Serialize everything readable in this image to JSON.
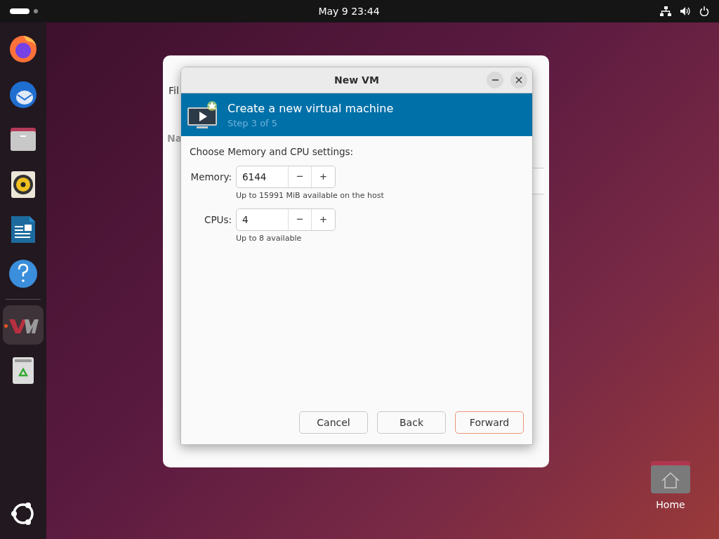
{
  "top_bar": {
    "clock": "May 9  23:44"
  },
  "dock": [
    {
      "kind": "firefox",
      "selected": false
    },
    {
      "kind": "thunderbird",
      "selected": false
    },
    {
      "kind": "files",
      "selected": false
    },
    {
      "kind": "rhythmbox",
      "selected": false
    },
    {
      "kind": "writer",
      "selected": false
    },
    {
      "kind": "help",
      "selected": false
    },
    {
      "kind": "vm",
      "selected": true
    },
    {
      "kind": "trash",
      "selected": false
    }
  ],
  "background_window": {
    "menu": "Fil",
    "column": "Na"
  },
  "dialog": {
    "title": "New VM",
    "banner": {
      "title": "Create a new virtual machine",
      "subtitle": "Step 3 of 5"
    },
    "heading": "Choose Memory and CPU settings:",
    "fields": [
      {
        "label": "Memory:",
        "value": "6144",
        "minus": "−",
        "plus": "+",
        "hint": "Up to 15991 MiB available on the host"
      },
      {
        "label": "CPUs:",
        "value": "4",
        "minus": "−",
        "plus": "+",
        "hint": "Up to 8 available"
      }
    ],
    "buttons": [
      {
        "label": "Cancel",
        "kind": "normal"
      },
      {
        "label": "Back",
        "kind": "normal"
      },
      {
        "label": "Forward",
        "kind": "default"
      }
    ]
  },
  "desktop_icons": [
    {
      "label": "Home"
    }
  ]
}
